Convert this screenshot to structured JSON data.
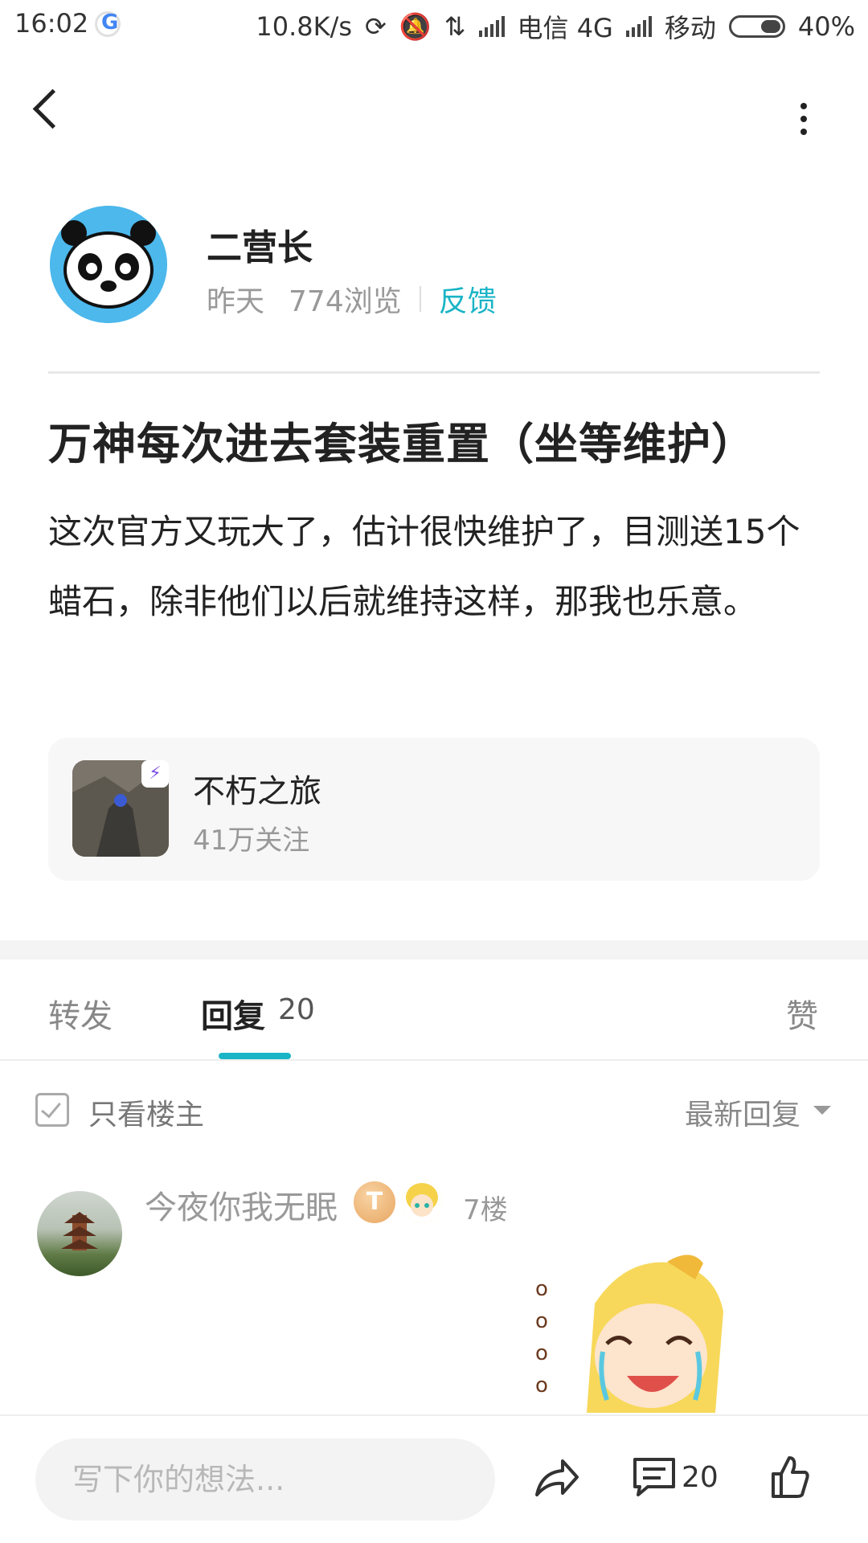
{
  "status_bar": {
    "time": "16:02",
    "net_speed": "10.8K/s",
    "carrier1": "电信 4G",
    "carrier2": "移动",
    "battery": "40%"
  },
  "post": {
    "author": "二营长",
    "time": "昨天",
    "views": "774浏览",
    "feedback": "反馈",
    "title": "万神每次进去套装重置（坐等维护）",
    "body": "这次官方又玩大了，估计很快维护了，目测送15个蜡石，除非他们以后就维持这样，那我也乐意。"
  },
  "game_card": {
    "name": "不朽之旅",
    "followers": "41万关注"
  },
  "tabs": {
    "forward": "转发",
    "reply": "回复",
    "reply_count": "20",
    "like": "赞",
    "accent_color": "#1ab4c6"
  },
  "filters": {
    "only_op": "只看楼主",
    "sort": "最新回复"
  },
  "comment": {
    "user": "今夜你我无眠",
    "level": "T",
    "floor": "7楼"
  },
  "bottom_bar": {
    "input_placeholder": "写下你的想法...",
    "comment_count": "20"
  }
}
